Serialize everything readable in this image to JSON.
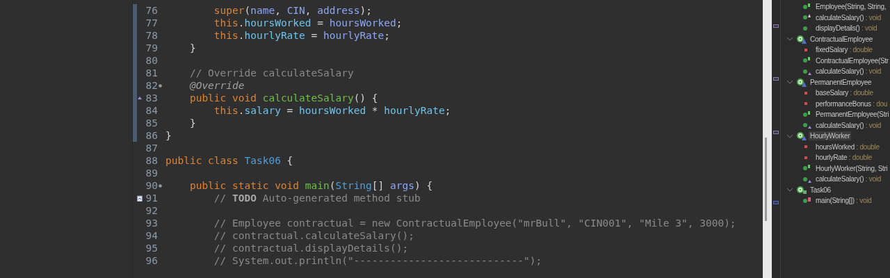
{
  "editor": {
    "lines": [
      {
        "number": "76",
        "in_range": true,
        "tokens": [
          {
            "kind": "keyword",
            "t": "        super"
          },
          {
            "kind": "plain",
            "t": "("
          },
          {
            "kind": "param",
            "t": "name"
          },
          {
            "kind": "plain",
            "t": ", "
          },
          {
            "kind": "param",
            "t": "CIN"
          },
          {
            "kind": "plain",
            "t": ", "
          },
          {
            "kind": "param",
            "t": "address"
          },
          {
            "kind": "plain",
            "t": ");"
          }
        ]
      },
      {
        "number": "77",
        "in_range": true,
        "tokens": [
          {
            "kind": "keyword",
            "t": "        this"
          },
          {
            "kind": "plain",
            "t": "."
          },
          {
            "kind": "field",
            "t": "hoursWorked"
          },
          {
            "kind": "plain",
            "t": " = "
          },
          {
            "kind": "param",
            "t": "hoursWorked"
          },
          {
            "kind": "plain",
            "t": ";"
          }
        ]
      },
      {
        "number": "78",
        "in_range": true,
        "tokens": [
          {
            "kind": "keyword",
            "t": "        this"
          },
          {
            "kind": "plain",
            "t": "."
          },
          {
            "kind": "field",
            "t": "hourlyRate"
          },
          {
            "kind": "plain",
            "t": " = "
          },
          {
            "kind": "param",
            "t": "hourlyRate"
          },
          {
            "kind": "plain",
            "t": ";"
          }
        ]
      },
      {
        "number": "79",
        "in_range": true,
        "tokens": [
          {
            "kind": "plain",
            "t": "    }"
          }
        ]
      },
      {
        "number": "80",
        "in_range": true
      },
      {
        "number": "81",
        "in_range": true,
        "tokens": [
          {
            "kind": "comment",
            "t": "    // Override calculateSalary"
          }
        ]
      },
      {
        "number": "82",
        "in_range": true,
        "fold_marker": true,
        "tokens": [
          {
            "kind": "annotation",
            "t": "    @Override"
          }
        ]
      },
      {
        "number": "83",
        "in_range": true,
        "override_marker": true,
        "tokens": [
          {
            "kind": "keyword",
            "t": "    public void "
          },
          {
            "kind": "method",
            "t": "calculateSalary"
          },
          {
            "kind": "plain",
            "t": "() {"
          }
        ]
      },
      {
        "number": "84",
        "in_range": true,
        "tokens": [
          {
            "kind": "keyword",
            "t": "        this"
          },
          {
            "kind": "plain",
            "t": "."
          },
          {
            "kind": "field",
            "t": "salary"
          },
          {
            "kind": "plain",
            "t": " = "
          },
          {
            "kind": "field",
            "t": "hoursWorked"
          },
          {
            "kind": "plain",
            "t": " * "
          },
          {
            "kind": "field",
            "t": "hourlyRate"
          },
          {
            "kind": "plain",
            "t": ";"
          }
        ]
      },
      {
        "number": "85",
        "in_range": true,
        "tokens": [
          {
            "kind": "plain",
            "t": "    }"
          }
        ]
      },
      {
        "number": "86",
        "in_range": true,
        "tokens": [
          {
            "kind": "plain",
            "t": "}"
          }
        ]
      },
      {
        "number": "87",
        "in_range": false
      },
      {
        "number": "88",
        "in_range": false,
        "tokens": [
          {
            "kind": "keyword",
            "t": "public class "
          },
          {
            "kind": "type",
            "t": "Task06"
          },
          {
            "kind": "plain",
            "t": " {"
          }
        ]
      },
      {
        "number": "89",
        "in_range": false
      },
      {
        "number": "90",
        "in_range": false,
        "fold_marker": true,
        "tokens": [
          {
            "kind": "keyword",
            "t": "    public static void "
          },
          {
            "kind": "method",
            "t": "main"
          },
          {
            "kind": "plain",
            "t": "("
          },
          {
            "kind": "type",
            "t": "String"
          },
          {
            "kind": "plain",
            "t": "[] "
          },
          {
            "kind": "param",
            "t": "args"
          },
          {
            "kind": "plain",
            "t": ") {"
          }
        ]
      },
      {
        "number": "91",
        "in_range": false,
        "task_marker": true,
        "tokens": [
          {
            "kind": "comment",
            "t": "        // "
          },
          {
            "kind": "todo",
            "t": "TODO"
          },
          {
            "kind": "comment",
            "t": " Auto-generated method stub"
          }
        ]
      },
      {
        "number": "92",
        "in_range": false
      },
      {
        "number": "93",
        "in_range": false,
        "tokens": [
          {
            "kind": "comment",
            "t": "        // Employee contractual = new ContractualEmployee(\"mrBull\", \"CIN001\", \"Mile 3\", 3000);"
          }
        ]
      },
      {
        "number": "94",
        "in_range": false,
        "tokens": [
          {
            "kind": "comment",
            "t": "        // contractual.calculateSalary();"
          }
        ]
      },
      {
        "number": "95",
        "in_range": false,
        "tokens": [
          {
            "kind": "comment",
            "t": "        // contractual.displayDetails();"
          }
        ]
      },
      {
        "number": "96",
        "in_range": false,
        "tokens": [
          {
            "kind": "comment",
            "t": "        // System.out.println(\"----------------------------\");"
          }
        ]
      }
    ]
  },
  "outline": [
    {
      "kind": "group",
      "children": [
        {
          "kind": "method",
          "constructor": true,
          "name": "Employee(String, String,"
        },
        {
          "kind": "method",
          "abstract": true,
          "name": "calculateSalary()",
          "type": " : void"
        },
        {
          "kind": "method",
          "name": "displayDetails()",
          "type": " : void"
        }
      ]
    },
    {
      "kind": "class",
      "expanded": true,
      "selected": false,
      "name": "ContractualEmployee",
      "children": [
        {
          "kind": "field",
          "name": "fixedSalary",
          "type": " : double"
        },
        {
          "kind": "method",
          "constructor": true,
          "name": "ContractualEmployee(Str"
        },
        {
          "kind": "method",
          "override": true,
          "name": "calculateSalary()",
          "type": " : void"
        }
      ]
    },
    {
      "kind": "class",
      "expanded": true,
      "selected": false,
      "name": "PermanentEmployee",
      "children": [
        {
          "kind": "field",
          "name": "baseSalary",
          "type": " : double"
        },
        {
          "kind": "field",
          "name": "performanceBonus",
          "type": " : dou"
        },
        {
          "kind": "method",
          "constructor": true,
          "name": "PermanentEmployee(Stri"
        },
        {
          "kind": "method",
          "override": true,
          "name": "calculateSalary()",
          "type": " : void"
        }
      ]
    },
    {
      "kind": "class",
      "expanded": true,
      "selected": true,
      "name": "HourlyWorker",
      "children": [
        {
          "kind": "field",
          "name": "hoursWorked",
          "type": " : double"
        },
        {
          "kind": "field",
          "name": "hourlyRate",
          "type": " : double"
        },
        {
          "kind": "method",
          "constructor": true,
          "name": "HourlyWorker(String, Stri"
        },
        {
          "kind": "method",
          "override": true,
          "name": "calculateSalary()",
          "type": " : void"
        }
      ]
    },
    {
      "kind": "class",
      "expanded": true,
      "selected": false,
      "main_class": true,
      "name": "Task06",
      "children": [
        {
          "kind": "method",
          "static": true,
          "name": "main(String[])",
          "type": " : void"
        }
      ]
    }
  ]
}
